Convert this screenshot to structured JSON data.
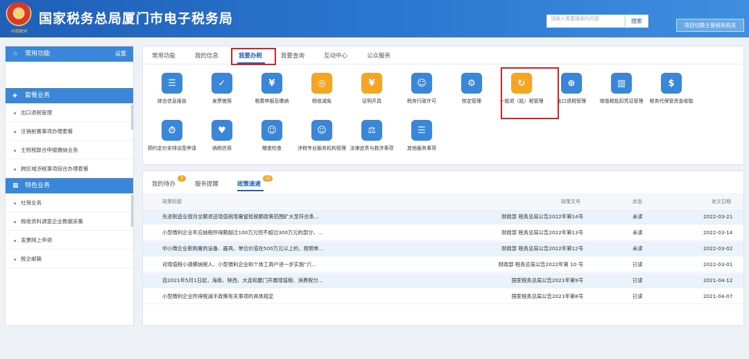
{
  "header": {
    "emblem_text": "中国税务",
    "title": "国家税务总局厦门市电子税务局",
    "search_placeholder": "请输入需要搜索的内容",
    "search_button": "搜索",
    "switch_button": "项目切换主管税务机关"
  },
  "sidebar": {
    "common": {
      "label": "常用功能",
      "settings": "设置"
    },
    "package": {
      "label": "套餐业务",
      "items": [
        "出口退税管理",
        "注销前置事项办理套餐",
        "主附税联合申报缴纳业务",
        "跨区域涉税事项综合办理套餐"
      ]
    },
    "special": {
      "label": "特色业务",
      "items": [
        "社保业务",
        "税收资料调查企业数据采集",
        "发票网上申领",
        "税企邮箱"
      ]
    }
  },
  "tabs": [
    "常用功能",
    "我的信息",
    "我要办税",
    "我要查询",
    "互动中心",
    "公众服务"
  ],
  "active_tab": "我要办税",
  "services_row1": [
    "综合信息报告",
    "发票使用",
    "税费申报及缴纳",
    "税收减免",
    "证明开具",
    "税务行政许可",
    "核定管理",
    "一般退（抵）税管理",
    "出口退税管理",
    "增值税抵扣凭证管理",
    "税务代保管资金收取"
  ],
  "services_row2": [
    "预约定价安排谈签申请",
    "纳税信用",
    "稽查检查",
    "涉税专业服务机构管理",
    "法律追责与救济事项",
    "其他服务事项"
  ],
  "icon_colors": {
    "primary": "#3a86d9",
    "teal": "#2bb3c0",
    "orange": "#f5a524",
    "green": "#38b46b",
    "highlight": "#e02020"
  },
  "bottom_tabs": [
    {
      "label": "我的待办",
      "badge": "7"
    },
    {
      "label": "服务提醒",
      "badge": ""
    },
    {
      "label": "政策速递",
      "badge": "10"
    }
  ],
  "table": {
    "headers": [
      "政策标题",
      "政策文号",
      "状态",
      "发文日期"
    ],
    "rows": [
      [
        "先进制造业按月全额退还增值税增量留抵税额政策范围扩大至符合条...",
        "财政部 税务总局公告2022年第14号",
        "未读",
        "2022-03-21"
      ],
      [
        "小型微利企业年应纳税所得额超过100万元但不超过300万元的部分，...",
        "财政部 税务总局公告2022年第13号",
        "未读",
        "2022-03-14"
      ],
      [
        "中小微企业新购置的设备、器具，单位价值在500万元以上的，按照单...",
        "财政部 税务总局公告2022年第12号",
        "未读",
        "2022-03-02"
      ],
      [
        "对增值税小规模纳税人、小型微利企业和个体工商户进一步实施“六...",
        "财政部 税务总局公告2022年第 10 号",
        "已读",
        "2022-03-01"
      ],
      [
        "自2021年5月1日起，海南、陕西、大连和厦门开展增值税、消费税分...",
        "国家税务总局公告2021年第9号",
        "已读",
        "2021-04-12"
      ],
      [
        "小型微利企业所得税减半政策有关事项的具体规定",
        "国家税务总局公告2021年第8号",
        "已读",
        "2021-04-07"
      ]
    ]
  }
}
